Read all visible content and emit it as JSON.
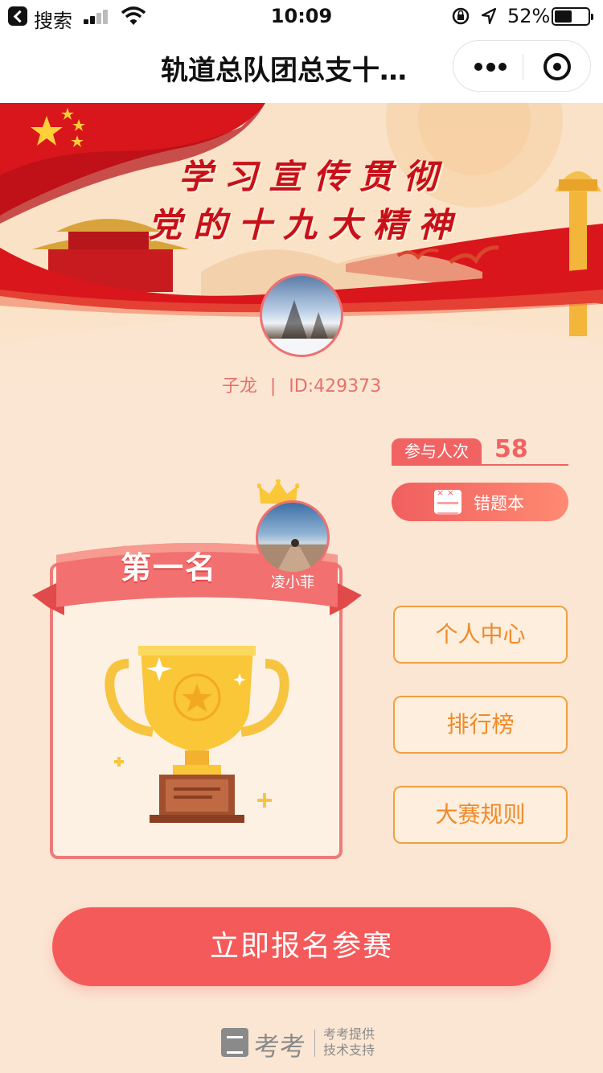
{
  "status_bar": {
    "back_app": "搜索",
    "time": "10:09",
    "battery_text": "52%",
    "battery_level": 0.52
  },
  "nav": {
    "title": "轨道总队团总支十…",
    "more_icon": "more-dots-icon",
    "close_icon": "mini-program-close-icon"
  },
  "banner": {
    "slogan_line1": "学习宣传贯彻",
    "slogan_line2": "党的十九大精神"
  },
  "user": {
    "name": "子龙",
    "separator": "|",
    "id": "ID:429373"
  },
  "stats": {
    "participants_label": "参与人次",
    "participants_value": "58"
  },
  "wrong_book": {
    "label": "错题本"
  },
  "leader": {
    "rank_label": "第一名",
    "name": "凌小菲"
  },
  "menu": {
    "personal": "个人中心",
    "ranking": "排行榜",
    "rules": "大赛规则"
  },
  "cta": {
    "label": "立即报名参赛"
  },
  "footer": {
    "brand": "考考",
    "note_line1": "考考提供",
    "note_line2": "技术支持"
  },
  "colors": {
    "accent_red": "#f55a5a",
    "accent_orange": "#f08a2a",
    "background": "#fbe6d3"
  }
}
